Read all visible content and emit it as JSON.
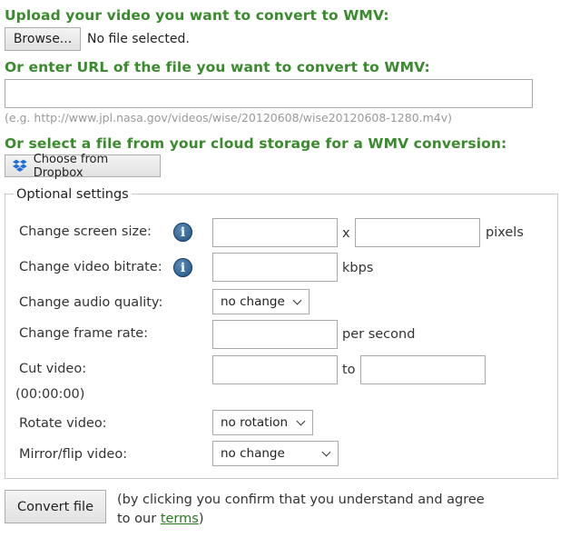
{
  "upload": {
    "heading": "Upload your video you want to convert to WMV:",
    "browse_label": "Browse...",
    "file_status": "No file selected."
  },
  "url": {
    "heading": "Or enter URL of the file you want to convert to WMV:",
    "value": "",
    "example": "(e.g. http://www.jpl.nasa.gov/videos/wise/20120608/wise20120608-1280.m4v)"
  },
  "cloud": {
    "heading": "Or select a file from your cloud storage for a WMV conversion:",
    "dropbox_label": "Choose from Dropbox",
    "dropbox_icon": "dropbox-icon"
  },
  "settings": {
    "legend": "Optional settings",
    "screen_size_label": "Change screen size:",
    "screen_size_sep": "x",
    "screen_size_unit": "pixels",
    "bitrate_label": "Change video bitrate:",
    "bitrate_unit": "kbps",
    "audio_label": "Change audio quality:",
    "audio_value": "no change",
    "frame_rate_label": "Change frame rate:",
    "frame_rate_unit": "per second",
    "cut_label": "Cut video:",
    "cut_format": "(00:00:00)",
    "cut_sep": "to",
    "rotate_label": "Rotate video:",
    "rotate_value": "no rotation",
    "mirror_label": "Mirror/flip video:",
    "mirror_value": "no change",
    "info_icon": "info-icon"
  },
  "submit": {
    "button_label": "Convert file",
    "note_before": "(by clicking you confirm that you understand and agree to our ",
    "terms_link": "terms",
    "note_after": ")"
  },
  "colors": {
    "heading_green": "#3a8a2e",
    "link_green": "#2a7a22",
    "dropbox_blue": "#1e6fd9"
  }
}
